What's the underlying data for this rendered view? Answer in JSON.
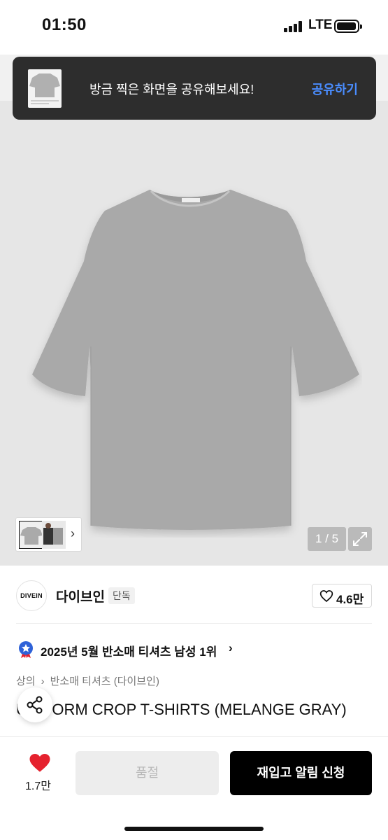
{
  "status_bar": {
    "time": "01:50",
    "network": "LTE"
  },
  "toast": {
    "message": "방금 찍은 화면을 공유해보세요!",
    "action": "공유하기"
  },
  "gallery": {
    "counter": "1 / 5"
  },
  "brand": {
    "logo_text": "DIVEIN",
    "name": "다이브인",
    "badge": "단독",
    "like_count": "4.6만"
  },
  "ranking": {
    "text": "2025년 5월 반소매 티셔츠 남성 1위",
    "chevron": "›"
  },
  "breadcrumb": {
    "items": [
      "상의",
      "반소매 티셔츠 (다이브인)"
    ],
    "separator": "›"
  },
  "product": {
    "title": "UNIFORM CROP T-SHIRTS (MELANGE GRAY)"
  },
  "bottom_bar": {
    "wish_count": "1.7만",
    "soldout_label": "품절",
    "restock_label": "재입고 알림 신청"
  },
  "colors": {
    "toast_bg": "#2d2d2d",
    "toast_action": "#4a8dff",
    "wish_heart": "#e5222e",
    "rank_badge": "#2f62d8",
    "shirt": "#a9a9a9"
  }
}
